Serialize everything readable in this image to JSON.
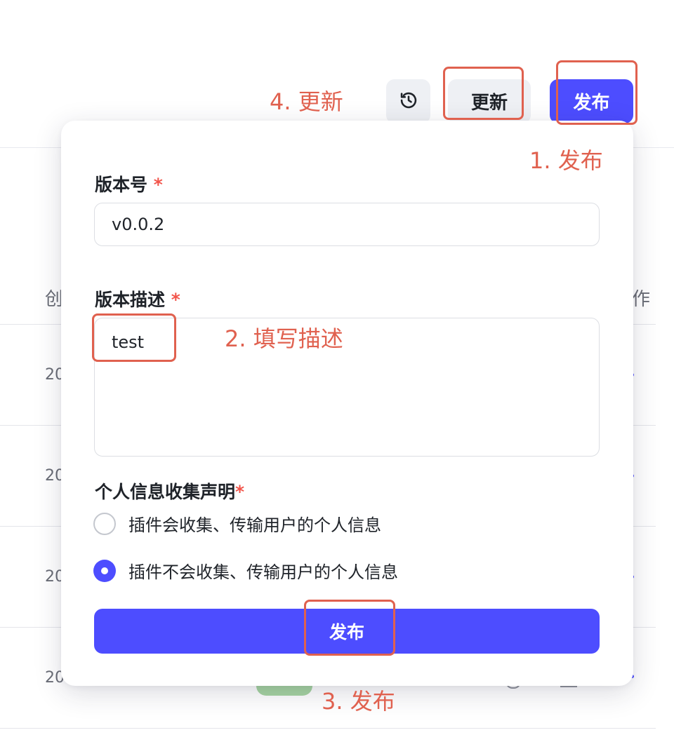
{
  "background": {
    "column_header_left": "创",
    "column_header_right": "作",
    "row_cells": [
      "20",
      "20",
      "20",
      "20"
    ]
  },
  "toolbar": {
    "history_icon": "history-clock-icon",
    "update_label": "更新",
    "publish_label": "发布"
  },
  "form": {
    "version_label": "版本号",
    "version_required": "*",
    "version_value": "v0.0.2",
    "description_label": "版本描述",
    "description_required": "*",
    "description_value": "test",
    "privacy_label": "个人信息收集声明",
    "privacy_required": "*",
    "privacy_options": [
      {
        "label": "插件会收集、传输用户的个人信息",
        "checked": false
      },
      {
        "label": "插件不会收集、传输用户的个人信息",
        "checked": true
      }
    ],
    "submit_label": "发布"
  },
  "annotations": {
    "step1": "1. 发布",
    "step2": "2. 填写描述",
    "step3": "3. 发布",
    "step4": "4. 更新"
  },
  "colors": {
    "primary": "#4d4dff",
    "annotation": "#e0614f",
    "required": "#f2554b"
  }
}
